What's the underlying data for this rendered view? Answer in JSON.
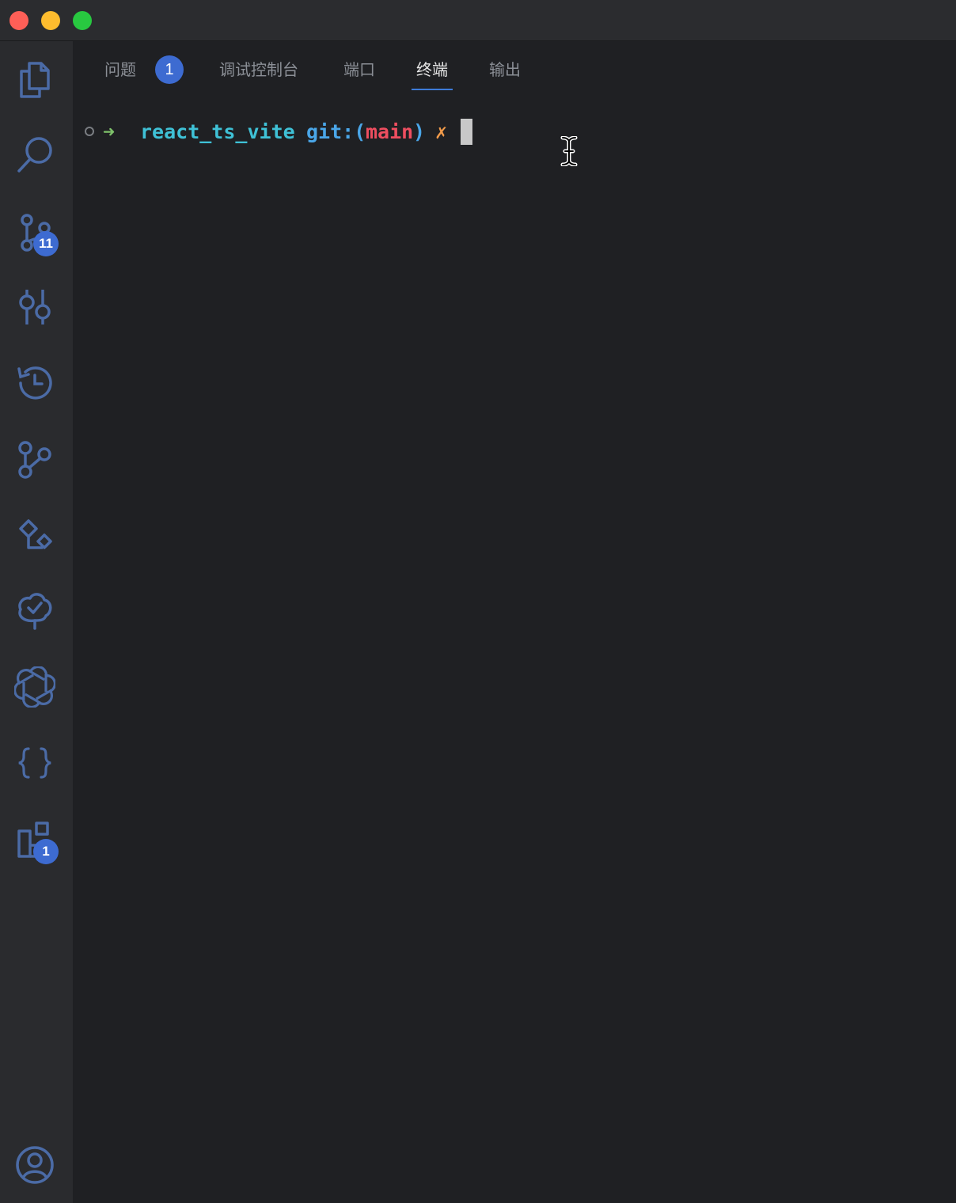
{
  "window": {
    "buttons": [
      "close",
      "minimize",
      "maximize"
    ]
  },
  "activity_bar": {
    "items": [
      {
        "icon": "files-icon"
      },
      {
        "icon": "search-icon"
      },
      {
        "icon": "source-control-icon",
        "badge": "11"
      },
      {
        "icon": "debug-icon"
      },
      {
        "icon": "timeline-icon"
      },
      {
        "icon": "git-graph-icon"
      },
      {
        "icon": "remote-explorer-icon"
      },
      {
        "icon": "test-tree-icon"
      },
      {
        "icon": "openai-icon"
      },
      {
        "icon": "json-braces-icon"
      },
      {
        "icon": "extensions-icon",
        "badge": "1"
      },
      {
        "icon": "account-icon"
      }
    ]
  },
  "panel": {
    "tabs": [
      {
        "label": "问题",
        "badge": "1"
      },
      {
        "label": "调试控制台"
      },
      {
        "label": "端口"
      },
      {
        "label": "终端",
        "active": true
      },
      {
        "label": "输出"
      }
    ]
  },
  "terminal": {
    "arrow": "➜",
    "directory": "react_ts_vite",
    "git_prefix": "git:(",
    "branch": "main",
    "git_suffix": ")",
    "dirty_mark": "✗"
  },
  "colors": {
    "accent": "#3d6bd1",
    "icon": "#4b6ba6",
    "prompt_arrow": "#7ec16a",
    "directory": "#3fc1d6",
    "git": "#4aa6e8",
    "branch": "#ee4e60",
    "dirty": "#f09a4a"
  }
}
